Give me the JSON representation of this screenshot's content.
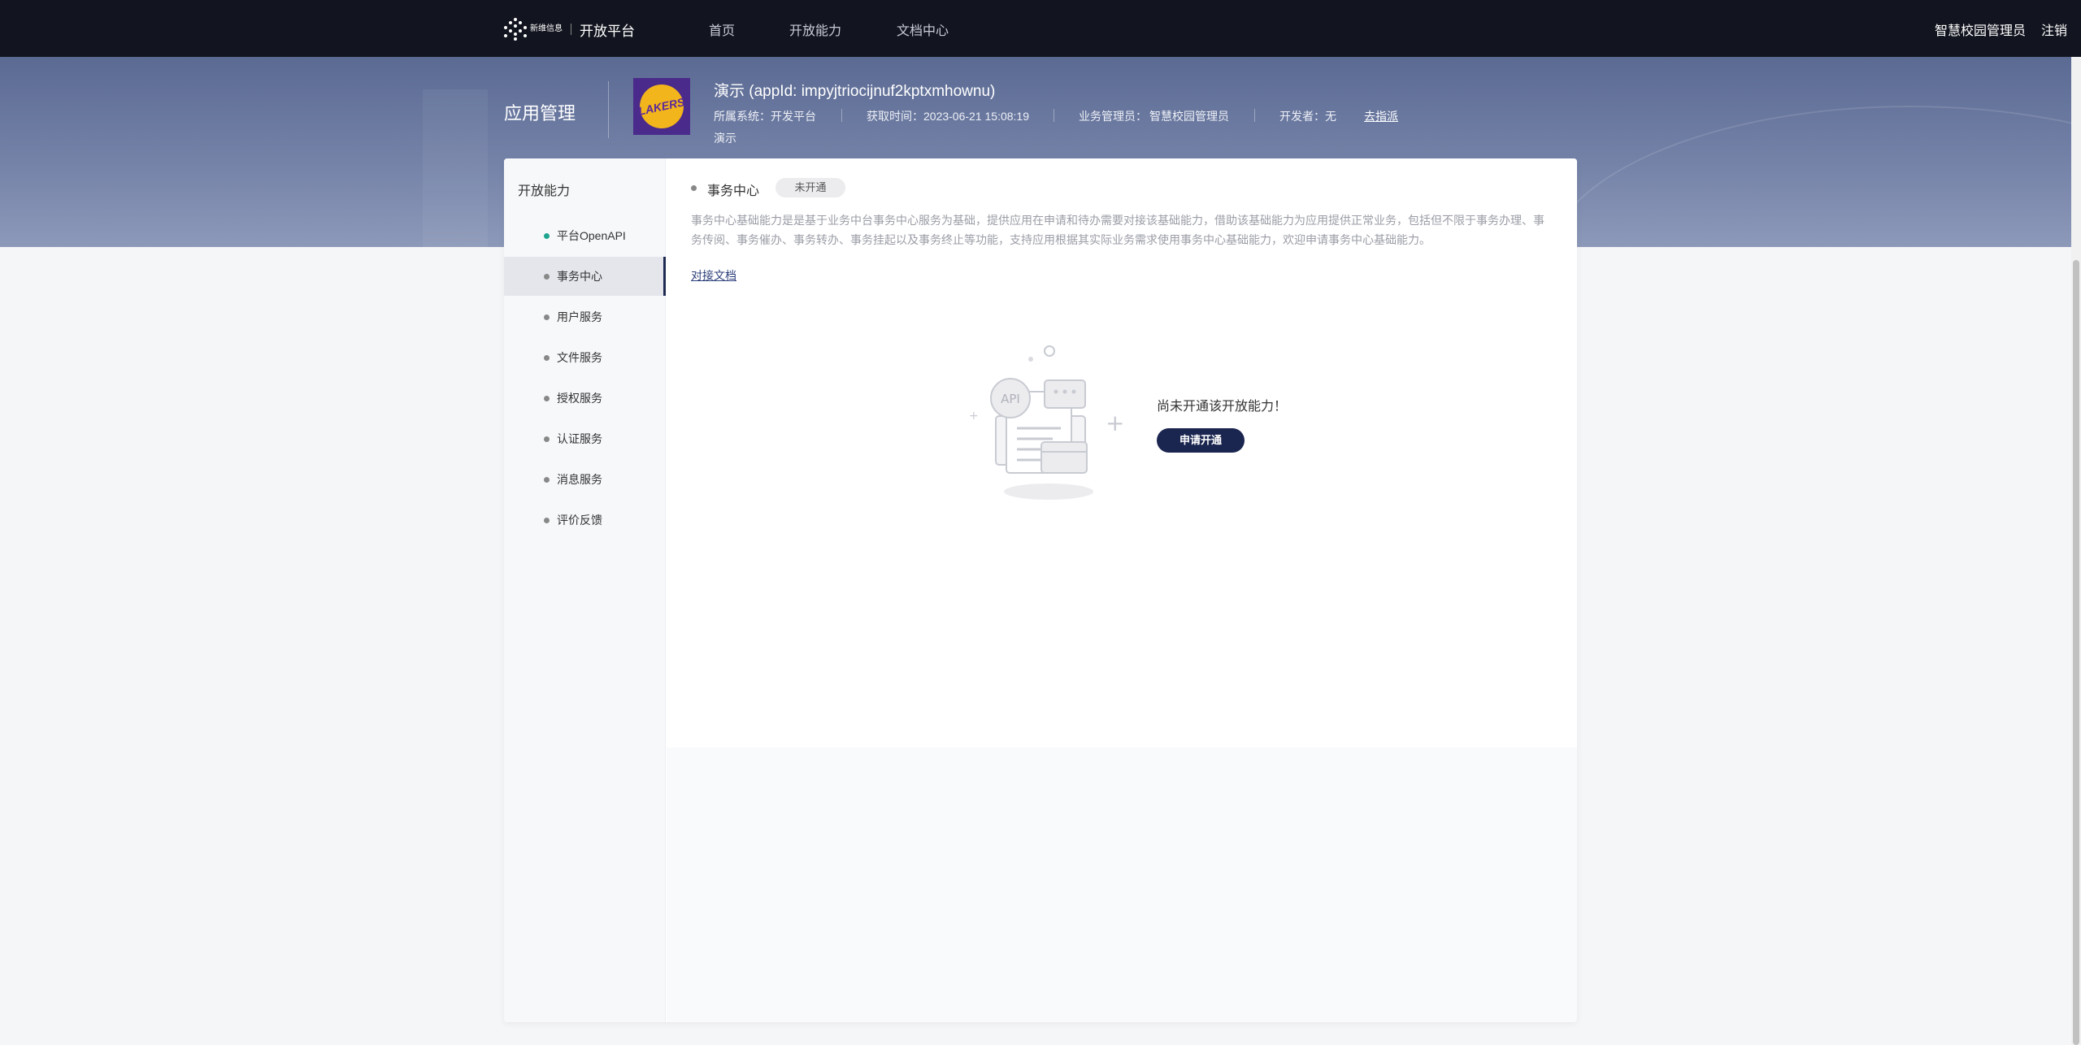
{
  "nav": {
    "logo_small": "新维信息",
    "logo_title": "开放平台",
    "items": [
      "首页",
      "开放能力",
      "文档中心"
    ],
    "user": "智慧校园管理员",
    "logout": "注销"
  },
  "banner": {
    "title": "应用管理",
    "app_name": "演示 (appId: impyjtriocijnuf2kptxmhownu)",
    "app_logo_text": "LAKERS",
    "meta": {
      "system": "所属系统：开发平台",
      "time": "获取时间：2023-06-21 15:08:19",
      "admin_label": "业务管理员：",
      "admin_value": "智慧校园管理员",
      "developer": "开发者：无",
      "assign_link": "去指派"
    },
    "desc": "演示"
  },
  "sidebar": {
    "title": "开放能力",
    "items": [
      {
        "label": "平台OpenAPI"
      },
      {
        "label": "事务中心"
      },
      {
        "label": "用户服务"
      },
      {
        "label": "文件服务"
      },
      {
        "label": "授权服务"
      },
      {
        "label": "认证服务"
      },
      {
        "label": "消息服务"
      },
      {
        "label": "评价反馈"
      }
    ]
  },
  "content": {
    "title": "事务中心",
    "badge": "未开通",
    "description": "事务中心基础能力是是基于业务中台事务中心服务为基础，提供应用在申请和待办需要对接该基础能力，借助该基础能力为应用提供正常业务，包括但不限于事务办理、事务传阅、事务催办、事务转办、事务挂起以及事务终止等功能，支持应用根据其实际业务需求使用事务中心基础能力，欢迎申请事务中心基础能力。",
    "doc_link": "对接文档",
    "empty_text": "尚未开通该开放能力！",
    "apply_button": "申请开通",
    "illus_label": "API"
  },
  "colors": {
    "nav_bg": "#12151f",
    "accent": "#1b2650",
    "active_dot": "#1fa58f"
  }
}
